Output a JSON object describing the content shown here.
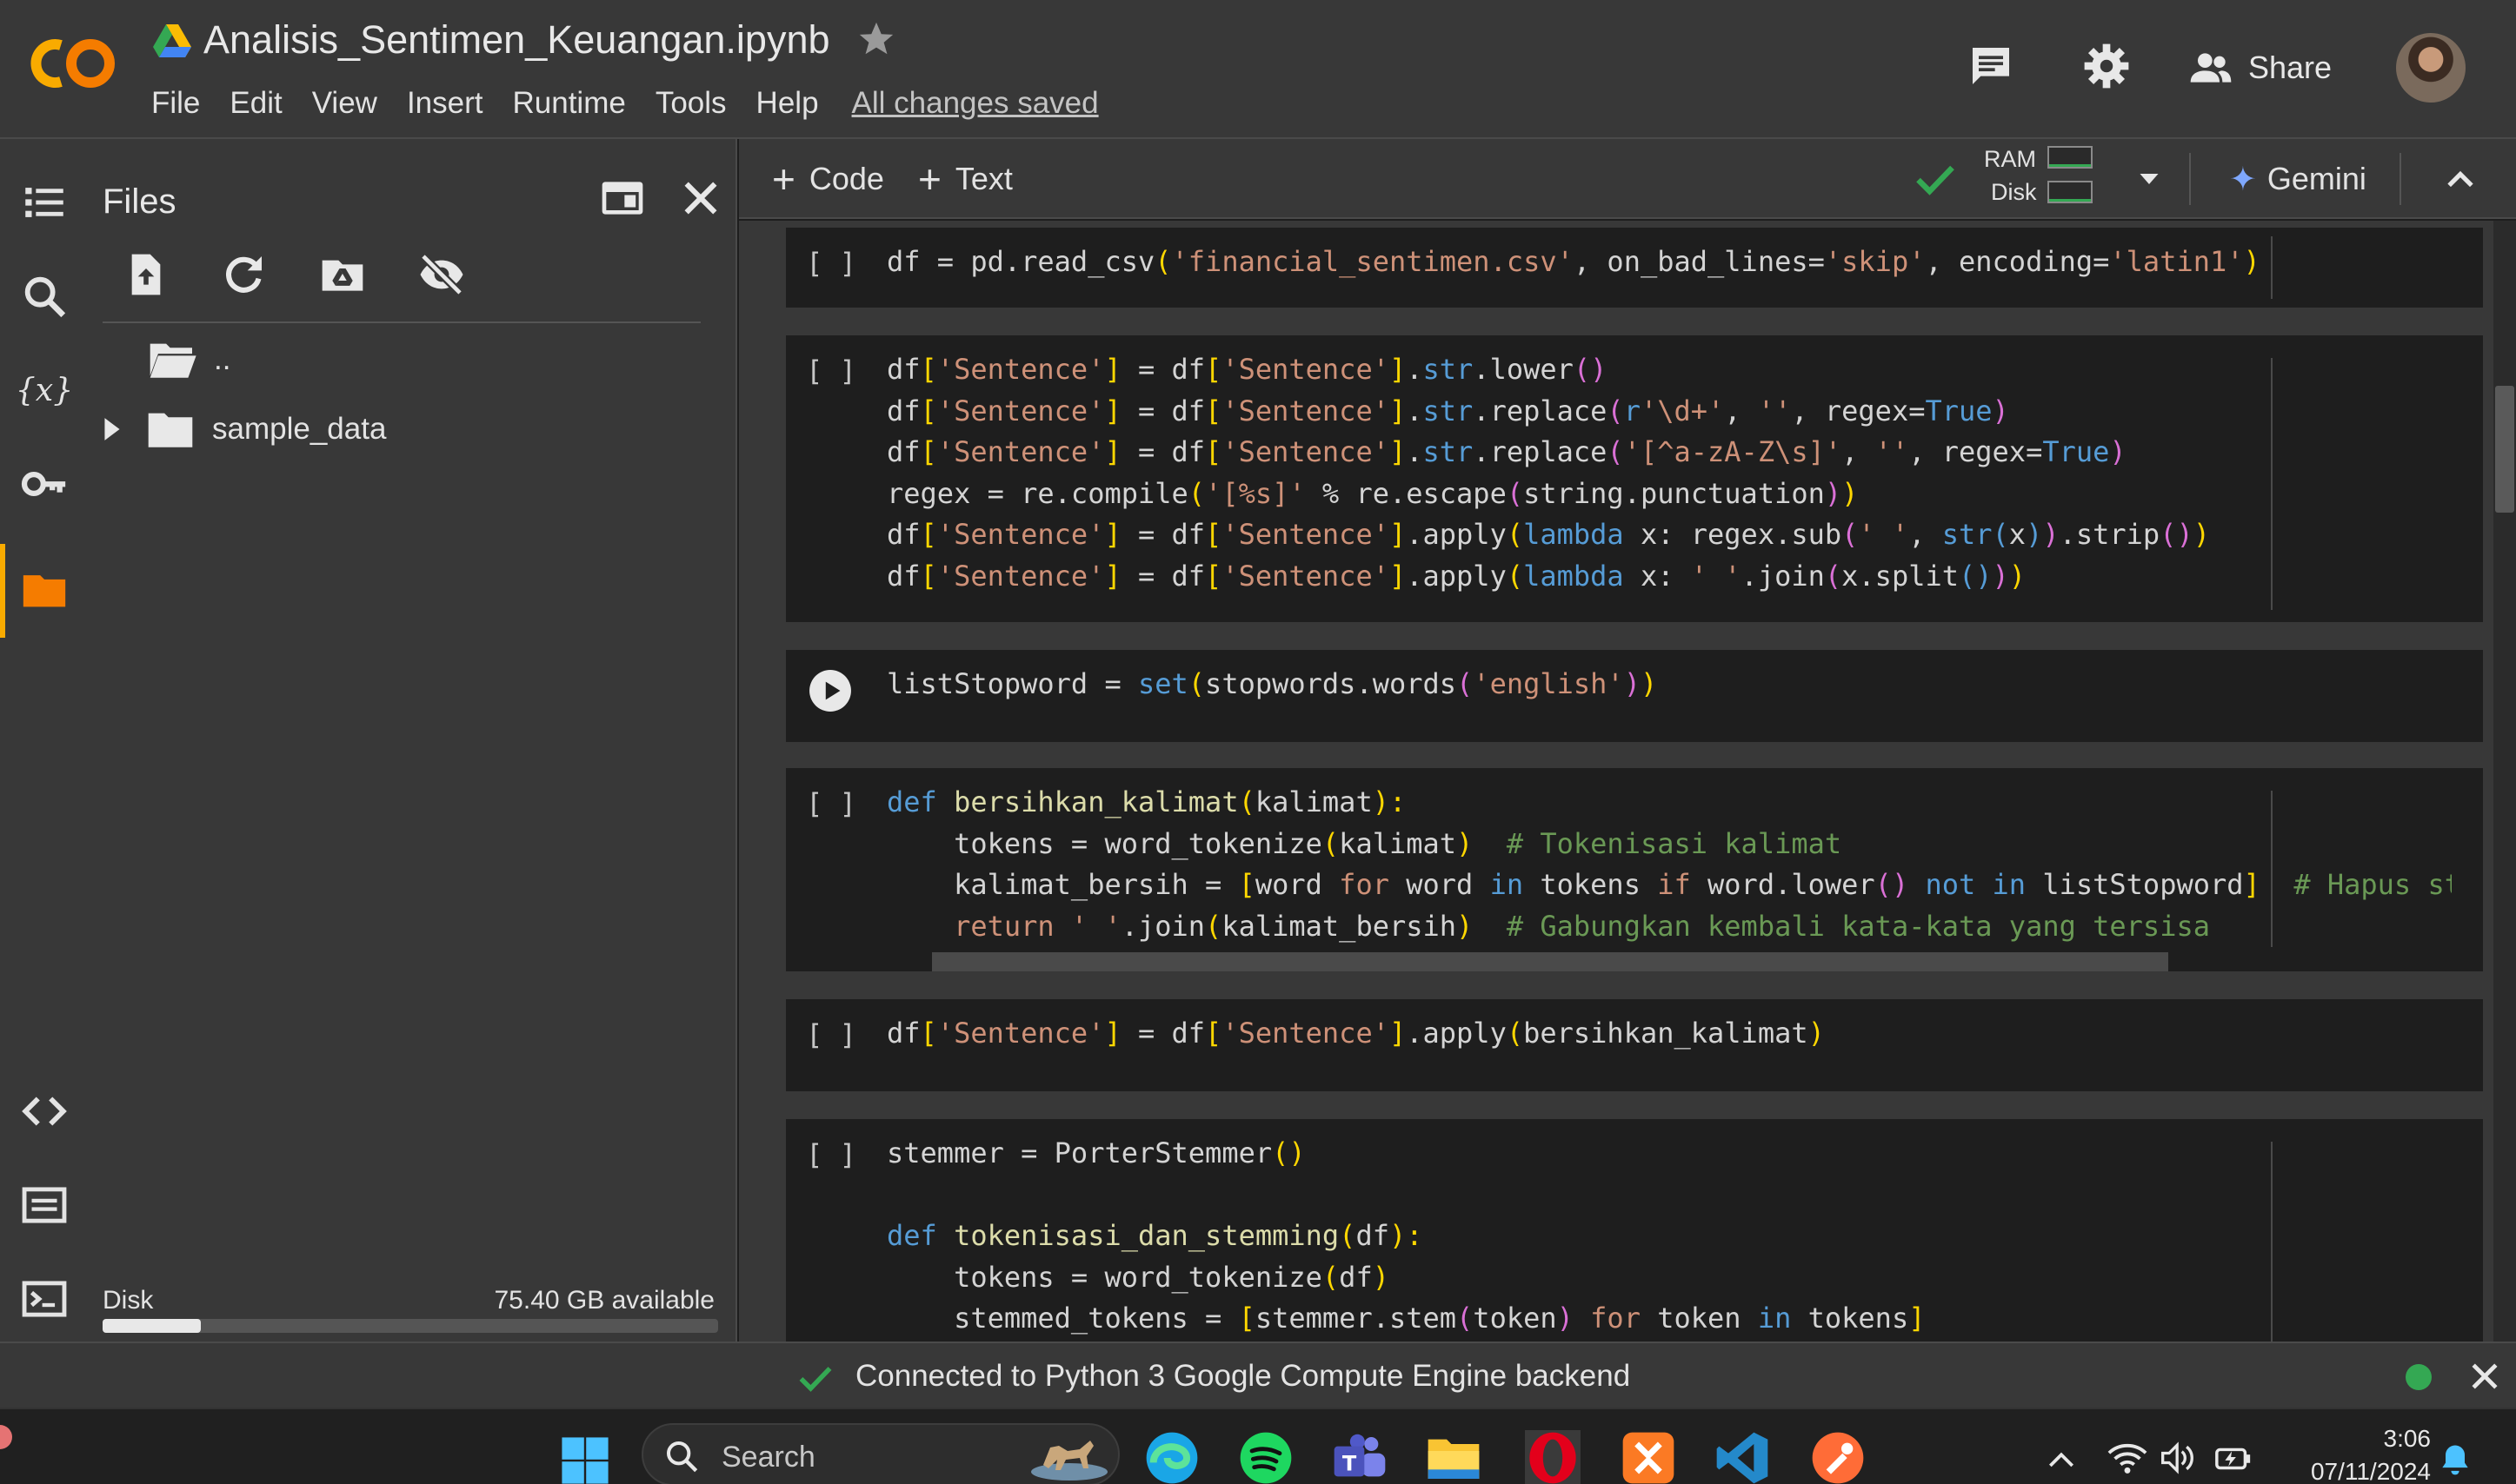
{
  "header": {
    "title": "Analisis_Sentimen_Keuangan.ipynb",
    "menu": [
      "File",
      "Edit",
      "View",
      "Insert",
      "Runtime",
      "Tools",
      "Help"
    ],
    "saved_status": "All changes saved",
    "share_label": "Share",
    "icons": [
      "colab-logo",
      "drive-icon",
      "star-icon",
      "comment-icon",
      "settings-icon",
      "share-person-icon",
      "avatar"
    ]
  },
  "rail": {
    "icons": [
      "table-of-contents-icon",
      "search-icon",
      "variables-icon",
      "secrets-key-icon",
      "folder-icon",
      "code-snippets-icon",
      "command-palette-icon",
      "terminal-icon"
    ],
    "active": "folder-icon"
  },
  "files": {
    "title": "Files",
    "toolbar_icons": [
      "upload-file-icon",
      "refresh-icon",
      "mount-drive-icon",
      "hide-files-icon"
    ],
    "tree": [
      {
        "name": "..",
        "type": "parent-folder"
      },
      {
        "name": "sample_data",
        "type": "folder",
        "expanded": false
      }
    ],
    "disk_label": "Disk",
    "disk_available": "75.40 GB available",
    "disk_used_fraction": 0.16
  },
  "toolbar": {
    "add_code": "Code",
    "add_text": "Text",
    "ram_label": "RAM",
    "disk_label": "Disk",
    "gemini_label": "Gemini"
  },
  "cells": [
    {
      "id": "cell1",
      "bracket": "[ ]",
      "lines": [
        [
          [
            "n",
            "df = pd.read_csv"
          ],
          [
            "p",
            "("
          ],
          [
            "s",
            "'financial_sentimen.csv'"
          ],
          [
            "n",
            ", on_bad_lines="
          ],
          [
            "s",
            "'skip'"
          ],
          [
            "n",
            ", encoding="
          ],
          [
            "s",
            "'latin1'"
          ],
          [
            "p",
            ")"
          ]
        ]
      ]
    },
    {
      "id": "cell2",
      "bracket": "[ ]",
      "lines": [
        [
          [
            "n",
            "df"
          ],
          [
            "p",
            "["
          ],
          [
            "s",
            "'Sentence'"
          ],
          [
            "p",
            "]"
          ],
          [
            "n",
            " = df"
          ],
          [
            "p",
            "["
          ],
          [
            "s",
            "'Sentence'"
          ],
          [
            "p",
            "]"
          ],
          [
            "n",
            "."
          ],
          [
            "k",
            "str"
          ],
          [
            "n",
            ".lower"
          ],
          [
            "q",
            "()"
          ]
        ],
        [
          [
            "n",
            "df"
          ],
          [
            "p",
            "["
          ],
          [
            "s",
            "'Sentence'"
          ],
          [
            "p",
            "]"
          ],
          [
            "n",
            " = df"
          ],
          [
            "p",
            "["
          ],
          [
            "s",
            "'Sentence'"
          ],
          [
            "p",
            "]"
          ],
          [
            "n",
            "."
          ],
          [
            "k",
            "str"
          ],
          [
            "n",
            ".replace"
          ],
          [
            "q",
            "("
          ],
          [
            "k",
            "r"
          ],
          [
            "s",
            "'\\d+'"
          ],
          [
            "n",
            ", "
          ],
          [
            "s",
            "''"
          ],
          [
            "n",
            ", regex="
          ],
          [
            "k",
            "True"
          ],
          [
            "q",
            ")"
          ]
        ],
        [
          [
            "n",
            "df"
          ],
          [
            "p",
            "["
          ],
          [
            "s",
            "'Sentence'"
          ],
          [
            "p",
            "]"
          ],
          [
            "n",
            " = df"
          ],
          [
            "p",
            "["
          ],
          [
            "s",
            "'Sentence'"
          ],
          [
            "p",
            "]"
          ],
          [
            "n",
            "."
          ],
          [
            "k",
            "str"
          ],
          [
            "n",
            ".replace"
          ],
          [
            "q",
            "("
          ],
          [
            "s",
            "'[^a-zA-Z\\s]'"
          ],
          [
            "n",
            ", "
          ],
          [
            "s",
            "''"
          ],
          [
            "n",
            ", regex="
          ],
          [
            "k",
            "True"
          ],
          [
            "q",
            ")"
          ]
        ],
        [
          [
            "n",
            "regex = re.compile"
          ],
          [
            "p",
            "("
          ],
          [
            "s",
            "'[%s]'"
          ],
          [
            "n",
            " % re.escape"
          ],
          [
            "q",
            "("
          ],
          [
            "n",
            "string.punctuation"
          ],
          [
            "q",
            ")"
          ],
          [
            "p",
            ")"
          ]
        ],
        [
          [
            "n",
            "df"
          ],
          [
            "p",
            "["
          ],
          [
            "s",
            "'Sentence'"
          ],
          [
            "p",
            "]"
          ],
          [
            "n",
            " = df"
          ],
          [
            "p",
            "["
          ],
          [
            "s",
            "'Sentence'"
          ],
          [
            "p",
            "]"
          ],
          [
            "n",
            ".apply"
          ],
          [
            "p",
            "("
          ],
          [
            "k",
            "lambda"
          ],
          [
            "n",
            " x: regex.sub"
          ],
          [
            "q",
            "("
          ],
          [
            "s",
            "' '"
          ],
          [
            "n",
            ", "
          ],
          [
            "k",
            "str"
          ],
          [
            "k",
            "("
          ],
          [
            "n",
            "x"
          ],
          [
            "k",
            ")"
          ],
          [
            "q",
            ")"
          ],
          [
            "n",
            ".strip"
          ],
          [
            "q",
            "()"
          ],
          [
            "p",
            ")"
          ]
        ],
        [
          [
            "n",
            "df"
          ],
          [
            "p",
            "["
          ],
          [
            "s",
            "'Sentence'"
          ],
          [
            "p",
            "]"
          ],
          [
            "n",
            " = df"
          ],
          [
            "p",
            "["
          ],
          [
            "s",
            "'Sentence'"
          ],
          [
            "p",
            "]"
          ],
          [
            "n",
            ".apply"
          ],
          [
            "p",
            "("
          ],
          [
            "k",
            "lambda"
          ],
          [
            "n",
            " x: "
          ],
          [
            "s",
            "' '"
          ],
          [
            "n",
            ".join"
          ],
          [
            "q",
            "("
          ],
          [
            "n",
            "x.split"
          ],
          [
            "k",
            "()"
          ],
          [
            "q",
            ")"
          ],
          [
            "p",
            ")"
          ]
        ]
      ]
    },
    {
      "id": "cell3",
      "bracket": "",
      "lines": [
        [
          [
            "n",
            "listStopword = "
          ],
          [
            "k",
            "set"
          ],
          [
            "p",
            "("
          ],
          [
            "n",
            "stopwords.words"
          ],
          [
            "q",
            "("
          ],
          [
            "s",
            "'english'"
          ],
          [
            "q",
            ")"
          ],
          [
            "p",
            ")"
          ]
        ]
      ]
    },
    {
      "id": "cell4",
      "bracket": "[ ]",
      "lines": [
        [
          [
            "k",
            "def"
          ],
          [
            "n",
            " "
          ],
          [
            "f",
            "bersihkan_kalimat"
          ],
          [
            "p",
            "("
          ],
          [
            "n",
            "kalimat"
          ],
          [
            "p",
            "):"
          ]
        ],
        [
          [
            "n",
            "    tokens = word_tokenize"
          ],
          [
            "p",
            "("
          ],
          [
            "n",
            "kalimat"
          ],
          [
            "p",
            ")"
          ],
          [
            "n",
            "  "
          ],
          [
            "c",
            "# Tokenisasi kalimat"
          ]
        ],
        [
          [
            "n",
            "    kalimat_bersih = "
          ],
          [
            "p",
            "["
          ],
          [
            "n",
            "word "
          ],
          [
            "s",
            "for"
          ],
          [
            "n",
            " word "
          ],
          [
            "k",
            "in"
          ],
          [
            "n",
            " tokens "
          ],
          [
            "s",
            "if"
          ],
          [
            "n",
            " word.lower"
          ],
          [
            "q",
            "()"
          ],
          [
            "n",
            " "
          ],
          [
            "k",
            "not in"
          ],
          [
            "n",
            " listStopword"
          ],
          [
            "p",
            "]"
          ],
          [
            "n",
            "  "
          ],
          [
            "c",
            "# Hapus stopwords"
          ]
        ],
        [
          [
            "s",
            "    return"
          ],
          [
            "n",
            " "
          ],
          [
            "s",
            "' '"
          ],
          [
            "n",
            ".join"
          ],
          [
            "p",
            "("
          ],
          [
            "n",
            "kalimat_bersih"
          ],
          [
            "p",
            ")"
          ],
          [
            "n",
            "  "
          ],
          [
            "c",
            "# Gabungkan kembali kata-kata yang tersisa"
          ]
        ]
      ]
    },
    {
      "id": "cell5",
      "bracket": "[ ]",
      "lines": [
        [
          [
            "n",
            "df"
          ],
          [
            "p",
            "["
          ],
          [
            "s",
            "'Sentence'"
          ],
          [
            "p",
            "]"
          ],
          [
            "n",
            " = df"
          ],
          [
            "p",
            "["
          ],
          [
            "s",
            "'Sentence'"
          ],
          [
            "p",
            "]"
          ],
          [
            "n",
            ".apply"
          ],
          [
            "p",
            "("
          ],
          [
            "n",
            "bersihkan_kalimat"
          ],
          [
            "p",
            ")"
          ]
        ]
      ]
    },
    {
      "id": "cell6",
      "bracket": "[ ]",
      "lines": [
        [
          [
            "n",
            "stemmer = PorterStemmer"
          ],
          [
            "p",
            "()"
          ]
        ],
        [
          [
            "n",
            ""
          ]
        ],
        [
          [
            "k",
            "def"
          ],
          [
            "n",
            " "
          ],
          [
            "f",
            "tokenisasi_dan_stemming"
          ],
          [
            "p",
            "("
          ],
          [
            "n",
            "df"
          ],
          [
            "p",
            "):"
          ]
        ],
        [
          [
            "n",
            "    tokens = word_tokenize"
          ],
          [
            "p",
            "("
          ],
          [
            "n",
            "df"
          ],
          [
            "p",
            ")"
          ]
        ],
        [
          [
            "n",
            "    stemmed_tokens = "
          ],
          [
            "p",
            "["
          ],
          [
            "n",
            "stemmer.stem"
          ],
          [
            "q",
            "("
          ],
          [
            "n",
            "token"
          ],
          [
            "q",
            ")"
          ],
          [
            "n",
            " "
          ],
          [
            "s",
            "for"
          ],
          [
            "n",
            " token "
          ],
          [
            "k",
            "in"
          ],
          [
            "n",
            " tokens"
          ],
          [
            "p",
            "]"
          ]
        ]
      ]
    }
  ],
  "status_bar": {
    "text": "Connected to Python 3 Google Compute Engine backend"
  },
  "taskbar": {
    "search_placeholder": "Search",
    "apps": [
      "edge-icon",
      "spotify-icon",
      "teams-icon",
      "file-explorer-icon",
      "opera-icon",
      "xampp-icon",
      "vscode-icon",
      "postman-icon"
    ],
    "time": "3:06",
    "date": "07/11/2024"
  },
  "colors": {
    "accent_orange": "#f9ab00",
    "connected_green": "#34a853",
    "string": "#ce9178",
    "keyword": "#569cd6",
    "comment": "#6a9955"
  }
}
